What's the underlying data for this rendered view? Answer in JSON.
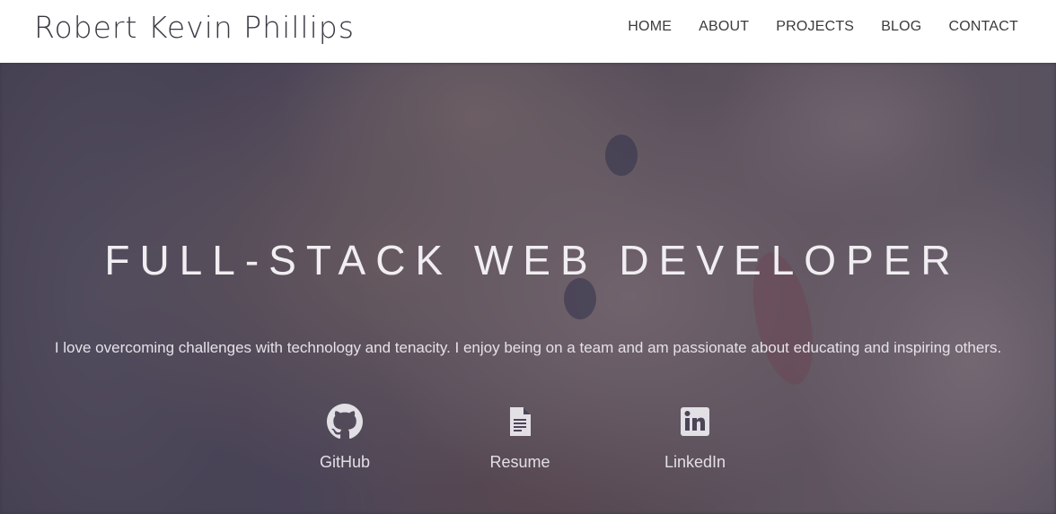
{
  "header": {
    "brand": "Robert Kevin Phillips",
    "nav": [
      {
        "label": "HOME"
      },
      {
        "label": "ABOUT"
      },
      {
        "label": "PROJECTS"
      },
      {
        "label": "BLOG"
      },
      {
        "label": "CONTACT"
      }
    ]
  },
  "hero": {
    "headline": "FULL-STACK WEB DEVELOPER",
    "tagline": "I love overcoming challenges with technology and tenacity. I enjoy being on a team and am passionate about educating and inspiring others.",
    "links": [
      {
        "label": "GitHub",
        "icon": "github-icon"
      },
      {
        "label": "Resume",
        "icon": "document-icon"
      },
      {
        "label": "LinkedIn",
        "icon": "linkedin-icon"
      }
    ]
  },
  "colors": {
    "header_bg": "#ffffff",
    "nav_text": "#3b3b3b",
    "hero_overlay": "#373048",
    "hero_text": "#f1eef2"
  }
}
